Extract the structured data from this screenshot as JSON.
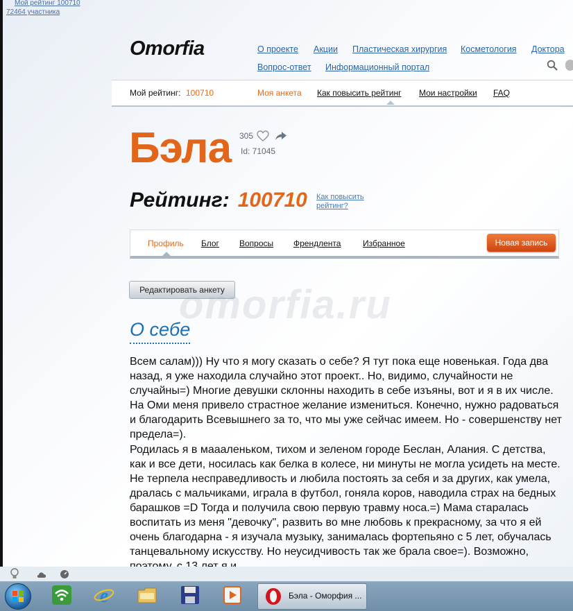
{
  "corner": {
    "rating_link": "Мой рейтинг 100710",
    "members_link": "72464 участника"
  },
  "header": {
    "logo": "Omorfia",
    "nav": [
      "О проекте",
      "Акции",
      "Пластическая хирургия",
      "Косметология",
      "Доктора",
      "Вопрос-ответ",
      "Информационный портал"
    ]
  },
  "subbar": {
    "my_rating_label": "Мой рейтинг:",
    "my_rating_value": "100710",
    "items": [
      "Моя анкета",
      "Как повысить рейтинг",
      "Мои настройки",
      "FAQ"
    ]
  },
  "profile": {
    "name": "Бэла",
    "likes": "305",
    "id": "Id: 71045",
    "rating_label": "Рейтинг:",
    "rating_value": "100710",
    "howto_line1": "Как повысить",
    "howto_line2": "рейтинг?"
  },
  "tabs": {
    "items": [
      "Профиль",
      "Блог",
      "Вопросы",
      "Френдлента",
      "Избранное"
    ],
    "new_post": "Новая запись"
  },
  "edit_button": "Редактировать анкету",
  "watermark": "omorfia.ru",
  "about": {
    "heading": "О себе",
    "para1": "Всем салам))) Ну что я могу сказать о себе? Я тут пока еще новенькая. Года два назад, я уже находила случайно этот проект.. Но, видимо, случайности не случайны=) Многие девушки склонны находить в себе изъяны, вот и я в их числе. На Оми меня привело страстное желание измениться. Конечно, нужно радоваться и благодарить Всевышнего за то, что мы уже сейчас имеем. Но - совершенству нет предела=).",
    "para2": "Родилась я в маааленьком, тихом и зеленом городе Беслан, Алания. С детства, как и все дети, носилась как белка в колесе, ни минуты не могла усидеть на месте. Не терпела несправедливость и любила постоять за себя и за других, как умела, дралась с мальчиками, играла в футбол, гоняла коров, наводила страх на бедных барашков =D Тогда и получила свою первую травму носа.=) Мама старалась воспитать из меня \"девочку\", развить во мне любовь к прекрасному, за что я ей очень благодарна - я изучала музыку, занималась фортепьяно с 5 лет, обучалась танцевальному искусству. Но неусидчивость так же брала свое=). Возможно, поэтому, с 13 лет я и"
  },
  "taskbar": {
    "active_window": "Бэла - Оморфия ..."
  },
  "colors": {
    "accent_orange": "#e2661a",
    "link_blue": "#2a64a6",
    "heading_blue": "#1c6fb3"
  }
}
